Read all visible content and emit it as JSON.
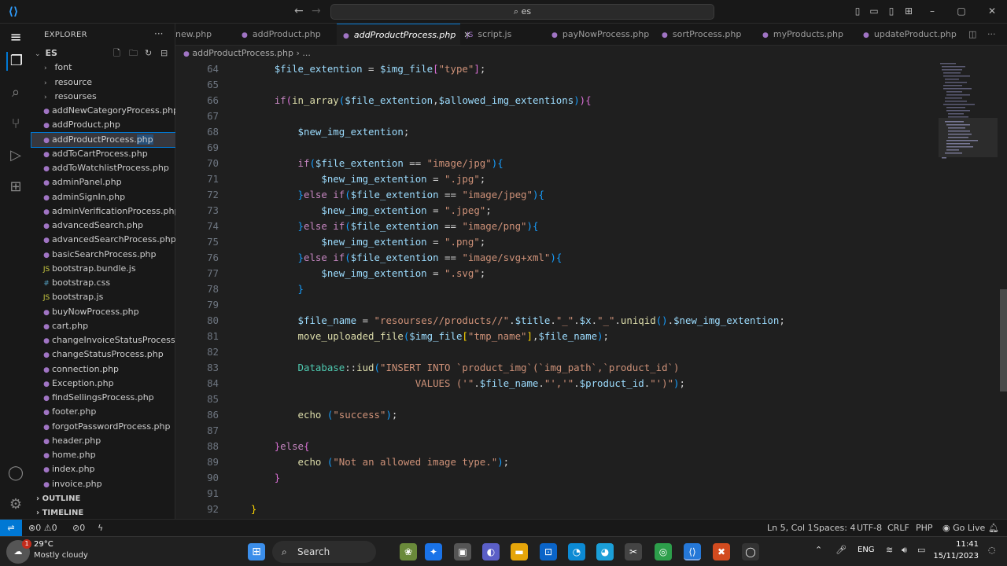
{
  "titlebar": {
    "search_text": "es",
    "back_icon": "←",
    "forward_icon": "→"
  },
  "explorer": {
    "title": "EXPLORER",
    "root": "ES",
    "folders": [
      "font",
      "resource",
      "resourses"
    ],
    "files": [
      {
        "name": "addNewCategoryProcess.php",
        "type": "php"
      },
      {
        "name": "addProduct.php",
        "type": "php"
      },
      {
        "name": "addProductProcess.php",
        "type": "php",
        "selected": true
      },
      {
        "name": "addToCartProcess.php",
        "type": "php"
      },
      {
        "name": "addToWatchlistProcess.php",
        "type": "php"
      },
      {
        "name": "adminPanel.php",
        "type": "php"
      },
      {
        "name": "adminSignIn.php",
        "type": "php"
      },
      {
        "name": "adminVerificationProcess.php",
        "type": "php"
      },
      {
        "name": "advancedSearch.php",
        "type": "php"
      },
      {
        "name": "advancedSearchProcess.php",
        "type": "php"
      },
      {
        "name": "basicSearchProcess.php",
        "type": "php"
      },
      {
        "name": "bootstrap.bundle.js",
        "type": "js"
      },
      {
        "name": "bootstrap.css",
        "type": "css"
      },
      {
        "name": "bootstrap.js",
        "type": "js"
      },
      {
        "name": "buyNowProcess.php",
        "type": "php"
      },
      {
        "name": "cart.php",
        "type": "php"
      },
      {
        "name": "changeInvoiceStatusProcess.p...",
        "type": "php"
      },
      {
        "name": "changeStatusProcess.php",
        "type": "php"
      },
      {
        "name": "connection.php",
        "type": "php"
      },
      {
        "name": "Exception.php",
        "type": "php"
      },
      {
        "name": "findSellingsProcess.php",
        "type": "php"
      },
      {
        "name": "footer.php",
        "type": "php"
      },
      {
        "name": "forgotPasswordProcess.php",
        "type": "php"
      },
      {
        "name": "header.php",
        "type": "php"
      },
      {
        "name": "home.php",
        "type": "php"
      },
      {
        "name": "index.php",
        "type": "php"
      },
      {
        "name": "invoice.php",
        "type": "php"
      }
    ],
    "outline": "OUTLINE",
    "timeline": "TIMELINE"
  },
  "tabs": [
    "new.php",
    "addProduct.php",
    "addProductProcess.php",
    "script.js",
    "payNowProcess.php",
    "sortProcess.php",
    "myProducts.php",
    "updateProduct.php"
  ],
  "breadcrumb": [
    "addProductProcess.php",
    "..."
  ],
  "editor": {
    "line_numbers": [
      "64",
      "65",
      "66",
      "67",
      "68",
      "69",
      "70",
      "71",
      "72",
      "73",
      "74",
      "75",
      "76",
      "77",
      "78",
      "79",
      "80",
      "81",
      "82",
      "83",
      "84",
      "85",
      "86",
      "87",
      "88",
      "89",
      "90",
      "91",
      "92"
    ]
  },
  "status": {
    "errors": "0",
    "warnings": "0",
    "ports": "0",
    "position": "Ln 5, Col 1",
    "spaces": "Spaces: 4",
    "encoding": "UTF-8",
    "eol": "CRLF",
    "language": "PHP",
    "golive": "Go Live"
  },
  "taskbar": {
    "temp": "29°C",
    "weather": "Mostly cloudy",
    "badge": "1",
    "search": "Search",
    "lang": "ENG",
    "time": "11:41",
    "date": "15/11/2023"
  }
}
